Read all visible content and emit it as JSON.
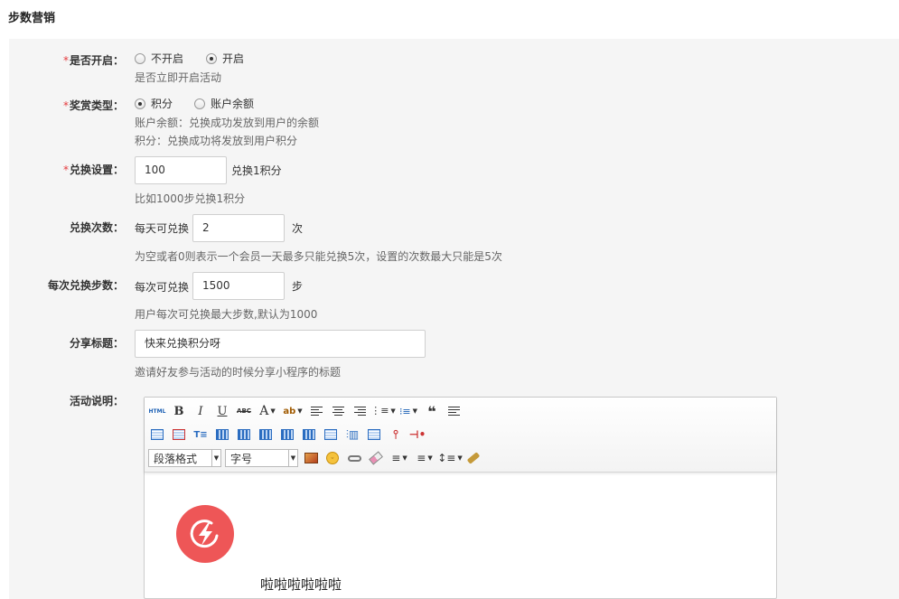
{
  "page": {
    "title": "步数营销"
  },
  "form": {
    "enable": {
      "required": "*",
      "label": "是否开启：",
      "options": [
        "不开启",
        "开启"
      ],
      "selected": "开启",
      "help": "是否立即开启活动"
    },
    "reward_type": {
      "required": "*",
      "label": "奖赏类型：",
      "options": [
        "积分",
        "账户余额"
      ],
      "selected": "积分",
      "help_1": "账户余额：兑换成功发放到用户的余额",
      "help_2": "积分：兑换成功将发放到用户积分"
    },
    "exchange_setting": {
      "required": "*",
      "label": "兑换设置：",
      "value": "100",
      "suffix": "兑换1积分",
      "help": "比如1000步兑换1积分"
    },
    "exchange_times": {
      "label": "兑换次数：",
      "prefix": "每天可兑换",
      "value": "2",
      "suffix": "次",
      "help": "为空或者0则表示一个会员一天最多只能兑换5次，设置的次数最大只能是5次"
    },
    "steps_per_exchange": {
      "label": "每次兑换步数：",
      "prefix": "每次可兑换",
      "value": "1500",
      "suffix": "步",
      "help": "用户每次可兑换最大步数,默认为1000"
    },
    "share_title": {
      "label": "分享标题：",
      "value": "快来兑换积分呀",
      "help": "邀请好友参与活动的时候分享小程序的标题"
    },
    "description": {
      "label": "活动说明：",
      "editor": {
        "html_button": "HTML",
        "paragraph_select": "段落格式",
        "font_size_select": "字号",
        "content_text": "啦啦啦啦啦啦"
      }
    }
  },
  "colors": {
    "required": "#e4393c",
    "logo": "#ee5657",
    "panel": "#f5f5f5"
  }
}
